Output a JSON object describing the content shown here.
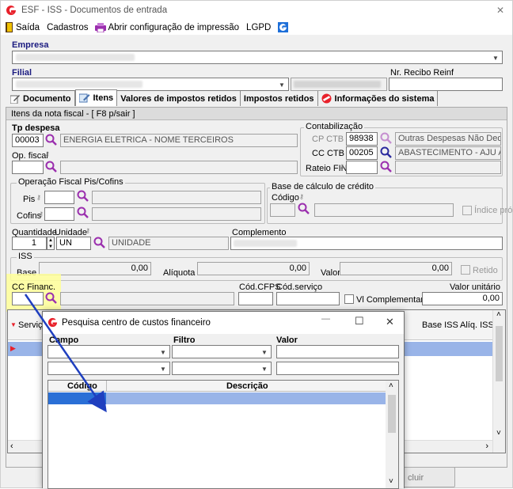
{
  "window": {
    "title": "ESF - ISS - Documentos de entrada",
    "close": "✕"
  },
  "menu": {
    "exit": "Saída",
    "registers": "Cadastros",
    "print_config": "Abrir configuração de impressão",
    "lgpd": "LGPD"
  },
  "header": {
    "company_label": "Empresa",
    "branch_label": "Filial",
    "receipt_label": "Nr. Recibo Reinf"
  },
  "tabs": [
    {
      "label": "Documento"
    },
    {
      "label": "Itens"
    },
    {
      "label": "Valores de impostos retidos"
    },
    {
      "label": "Impostos retidos"
    },
    {
      "label": "Informações do sistema"
    }
  ],
  "items": {
    "section_title": "Itens da nota fiscal - [ F8 p/sair ]",
    "expense_type_label": "Tp despesa",
    "expense_code": "00003",
    "expense_desc": "ENERGIA ELETRICA - NOME TERCEIROS",
    "fiscal_op_label": "Op. fiscal",
    "accounting_group": "Contabilização",
    "cp_ctb_label": "CP CTB",
    "cp_ctb_code": "98938",
    "cp_ctb_desc": "Outras Despesas Não Dedutíve",
    "cc_ctb_label": "CC CTB",
    "cc_ctb_code": "00205",
    "cc_ctb_desc": "ABASTECIMENTO - AJU ADM",
    "rateio_label": "Rateio FIN",
    "pis_cofins_group": "Operação Fiscal Pis/Cofins",
    "pis_label": "Pis",
    "cofins_label": "Cofins",
    "credit_base_group": "Base de cálculo de crédito",
    "code_label": "Código",
    "own_index_label": "Índice próprio",
    "qty_label": "Quantidade",
    "qty_value": "1",
    "unit_label": "Unidade",
    "unit_code": "UN",
    "unit_desc": "UNIDADE",
    "complement_label": "Complemento",
    "iss_group": "ISS",
    "base_label": "Base",
    "base_value": "0,00",
    "rate_label": "Alíquota",
    "rate_value": "0,00",
    "value_label": "Valor",
    "value_value": "0,00",
    "retained_label": "Retido",
    "cc_fin_label": "CC Financ.",
    "cfps_label": "Cód.CFPS",
    "service_code_label": "Cód.serviço",
    "vl_compl_label": "Vl Complementares",
    "unit_value_label": "Valor unitário",
    "unit_value": "0,00"
  },
  "grid": {
    "col_service": "Serviç",
    "col_base_iss": "Base ISS",
    "col_rate_iss": "Alíq. ISS"
  },
  "bottom": {
    "delete_btn": "cluir"
  },
  "popup": {
    "title": "Pesquisa centro de custos financeiro",
    "minimize": "—",
    "maximize": "☐",
    "close": "✕",
    "field_label": "Campo",
    "filter_label": "Filtro",
    "value_label": "Valor",
    "col_code": "Código",
    "col_desc": "Descrição"
  },
  "colors": {
    "accent": "#e8212b",
    "highlight": "#ffff99",
    "selected_row": "#99b4e8",
    "arrow": "#1f3fbf"
  }
}
